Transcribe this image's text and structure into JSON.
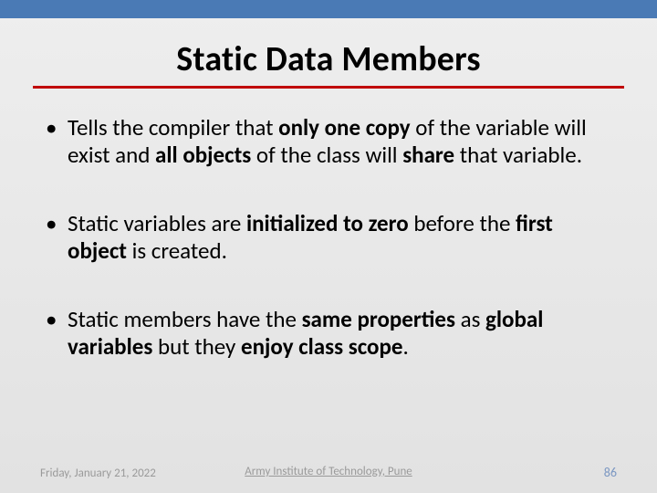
{
  "title": "Static Data Members",
  "bullets": [
    {
      "segments": [
        {
          "t": "Tells the compiler that ",
          "b": false
        },
        {
          "t": "only one copy",
          "b": true
        },
        {
          "t": " of the variable will exist and ",
          "b": false
        },
        {
          "t": "all objects",
          "b": true
        },
        {
          "t": " of the class will ",
          "b": false
        },
        {
          "t": "share",
          "b": true
        },
        {
          "t": " that variable.",
          "b": false
        }
      ]
    },
    {
      "segments": [
        {
          "t": "Static variables are ",
          "b": false
        },
        {
          "t": "initialized to zero",
          "b": true
        },
        {
          "t": " before the ",
          "b": false
        },
        {
          "t": "first object",
          "b": true
        },
        {
          "t": " is created.",
          "b": false
        }
      ]
    },
    {
      "segments": [
        {
          "t": "Static members have the ",
          "b": false
        },
        {
          "t": "same properties",
          "b": true
        },
        {
          "t": " as ",
          "b": false
        },
        {
          "t": "global variables",
          "b": true
        },
        {
          "t": " but they ",
          "b": false
        },
        {
          "t": "enjoy class scope",
          "b": true
        },
        {
          "t": ".",
          "b": false
        }
      ]
    }
  ],
  "footer": {
    "date": "Friday, January 21, 2022",
    "org": "Army Institute of Technology, Pune",
    "page": "86"
  }
}
